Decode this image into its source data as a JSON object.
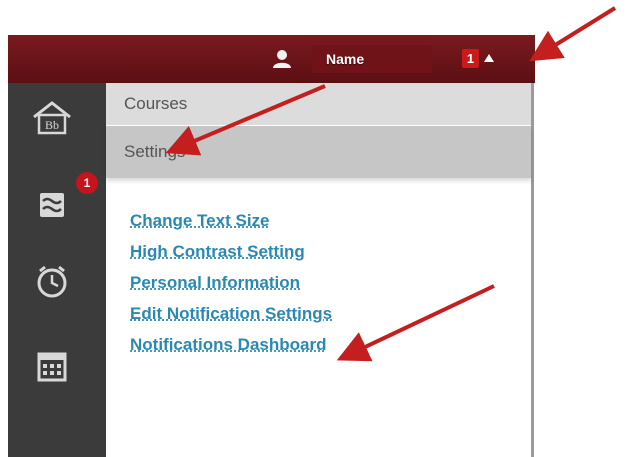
{
  "header": {
    "user_name": "Name",
    "notification_count": "1"
  },
  "rail": {
    "icons": [
      "blackboard-home-icon",
      "stream-icon",
      "alarm-clock-icon",
      "calendar-icon"
    ],
    "badge_count": "1"
  },
  "menu": {
    "tabs": [
      {
        "label": "Courses"
      },
      {
        "label": "Settings"
      }
    ],
    "links": [
      {
        "label": "Change Text Size"
      },
      {
        "label": "High Contrast Setting"
      },
      {
        "label": "Personal Information"
      },
      {
        "label": "Edit Notification Settings"
      },
      {
        "label": "Notifications Dashboard"
      }
    ]
  },
  "colors": {
    "topbar": "#6a1419",
    "rail": "#3b3b3b",
    "link": "#2a88b5",
    "arrow": "#c41e1e",
    "badge": "#c4141c"
  }
}
